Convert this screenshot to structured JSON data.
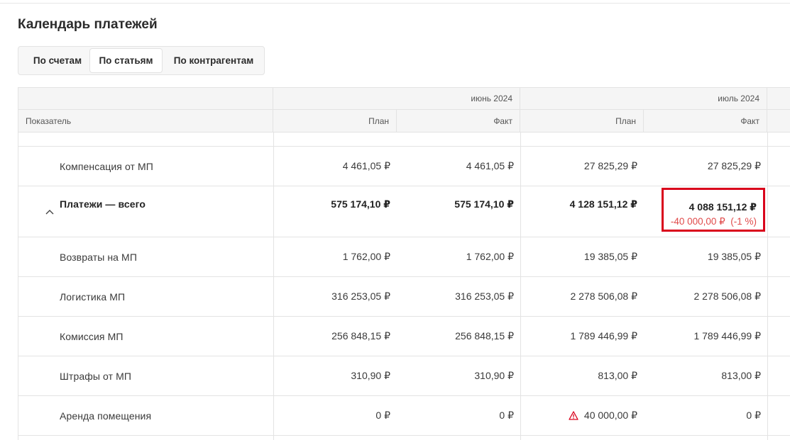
{
  "page": {
    "title": "Календарь платежей"
  },
  "tabs": [
    {
      "label": "По счетам",
      "active": false
    },
    {
      "label": "По статьям",
      "active": true
    },
    {
      "label": "По контрагентам",
      "active": false
    }
  ],
  "table": {
    "indicator_header": "Показатель",
    "periods": [
      "июнь 2024",
      "июль 2024"
    ],
    "sub_headers": [
      "План",
      "Факт",
      "План",
      "Факт"
    ],
    "rows": [
      {
        "label": "Компенсация от МП",
        "values": [
          "4 461,05 ₽",
          "4 461,05 ₽",
          "27 825,29 ₽",
          "27 825,29 ₽"
        ]
      },
      {
        "label": "Платежи — всего",
        "values": [
          "575 174,10 ₽",
          "575 174,10 ₽",
          "4 128 151,12 ₽",
          "4 088 151,12 ₽"
        ],
        "diff": "-40 000,00 ₽  (-1 %)"
      },
      {
        "label": "Возвраты на МП",
        "values": [
          "1 762,00 ₽",
          "1 762,00 ₽",
          "19 385,05 ₽",
          "19 385,05 ₽"
        ]
      },
      {
        "label": "Логистика МП",
        "values": [
          "316 253,05 ₽",
          "316 253,05 ₽",
          "2 278 506,08 ₽",
          "2 278 506,08 ₽"
        ]
      },
      {
        "label": "Комиссия МП",
        "values": [
          "256 848,15 ₽",
          "256 848,15 ₽",
          "1 789 446,99 ₽",
          "1 789 446,99 ₽"
        ]
      },
      {
        "label": "Штрафы от МП",
        "values": [
          "310,90 ₽",
          "310,90 ₽",
          "813,00 ₽",
          "813,00 ₽"
        ]
      },
      {
        "label": "Аренда помещения",
        "values": [
          "0 ₽",
          "0 ₽",
          "40 000,00 ₽",
          "0 ₽"
        ]
      }
    ]
  },
  "icons": {
    "collapse": "chevron-up-icon",
    "warning": "warning-triangle-icon"
  },
  "colors": {
    "negative": "#e04a4a",
    "highlight_border": "#d9001b",
    "warning": "#d9001b"
  }
}
